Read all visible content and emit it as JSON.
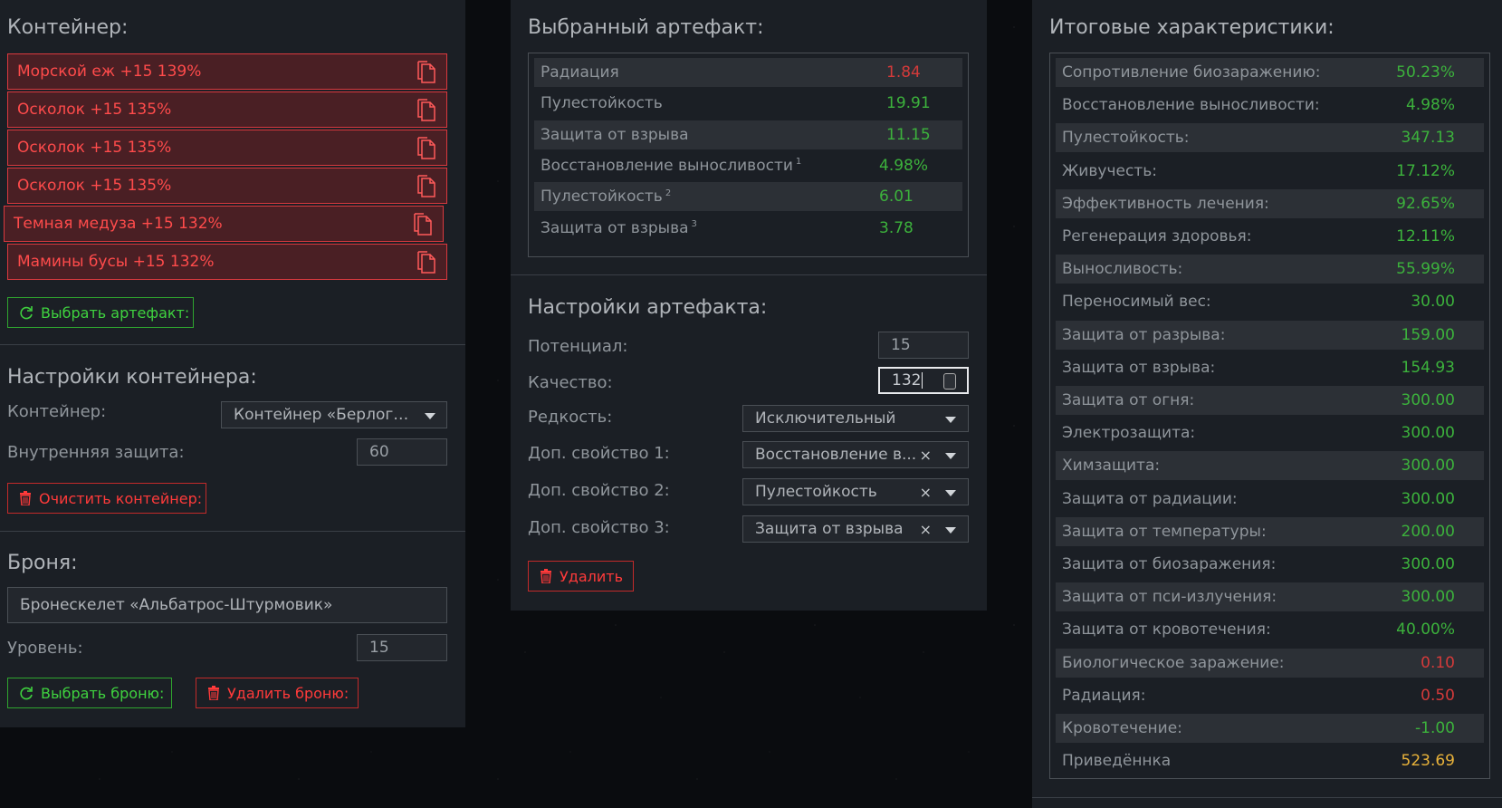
{
  "container": {
    "title": "Контейнер:",
    "artifacts": [
      {
        "label": "Морской еж +15 139%"
      },
      {
        "label": "Осколок +15 135%"
      },
      {
        "label": "Осколок +15 135%"
      },
      {
        "label": "Осколок +15 135%"
      },
      {
        "label": "Темная медуза +15 132%"
      },
      {
        "label": "Мамины бусы +15 132%"
      }
    ],
    "select_artifact_label": "Выбрать артефакт:"
  },
  "container_settings": {
    "title": "Настройки контейнера:",
    "container_label": "Контейнер:",
    "container_value": "Контейнер «Берлога...",
    "inner_protection_label": "Внутренняя защита:",
    "inner_protection_value": "60",
    "clear_label": "Очистить контейнер:"
  },
  "armor": {
    "title": "Броня:",
    "value": "Бронескелет «Альбатрос-Штурмовик»",
    "level_label": "Уровень:",
    "level_value": "15",
    "select_label": "Выбрать броню:",
    "delete_label": "Удалить броню:"
  },
  "selected_artifact": {
    "title": "Выбранный артефакт:",
    "rows": [
      {
        "name": "Радиация",
        "sup": "",
        "value": "1.84",
        "color": "red"
      },
      {
        "name": "Пулестойкость",
        "sup": "",
        "value": "19.91",
        "color": "green"
      },
      {
        "name": "Защита от взрыва",
        "sup": "",
        "value": "11.15",
        "color": "green"
      },
      {
        "name": "Восстановление выносливости",
        "sup": "1",
        "value": "4.98%",
        "color": "green"
      },
      {
        "name": "Пулестойкость",
        "sup": "2",
        "value": "6.01",
        "color": "green"
      },
      {
        "name": "Защита от взрыва",
        "sup": "3",
        "value": "3.78",
        "color": "green"
      }
    ]
  },
  "artifact_settings": {
    "title": "Настройки артефакта:",
    "potential_label": "Потенциал:",
    "potential_value": "15",
    "quality_label": "Качество:",
    "quality_value": "132",
    "rarity_label": "Редкость:",
    "rarity_value": "Исключительный",
    "extra1_label": "Доп. свойство 1:",
    "extra1_value": "Восстановление в...",
    "extra2_label": "Доп. свойство 2:",
    "extra2_value": "Пулестойкость",
    "extra3_label": "Доп. свойство 3:",
    "extra3_value": "Защита от взрыва",
    "clear_symbol": "×",
    "delete_label": "Удалить"
  },
  "totals": {
    "title": "Итоговые характеристики:",
    "rows": [
      {
        "name": "Сопротивление биозаражению:",
        "value": "50.23%",
        "color": "green"
      },
      {
        "name": "Восстановление выносливости:",
        "value": "4.98%",
        "color": "green"
      },
      {
        "name": "Пулестойкость:",
        "value": "347.13",
        "color": "green"
      },
      {
        "name": "Живучесть:",
        "value": "17.12%",
        "color": "green"
      },
      {
        "name": "Эффективность лечения:",
        "value": "92.65%",
        "color": "green"
      },
      {
        "name": "Регенерация здоровья:",
        "value": "12.11%",
        "color": "green"
      },
      {
        "name": "Выносливость:",
        "value": "55.99%",
        "color": "green"
      },
      {
        "name": "Переносимый вес:",
        "value": "30.00",
        "color": "green"
      },
      {
        "name": "Защита от разрыва:",
        "value": "159.00",
        "color": "green"
      },
      {
        "name": "Защита от взрыва:",
        "value": "154.93",
        "color": "green"
      },
      {
        "name": "Защита от огня:",
        "value": "300.00",
        "color": "green"
      },
      {
        "name": "Электрозащита:",
        "value": "300.00",
        "color": "green"
      },
      {
        "name": "Химзащита:",
        "value": "300.00",
        "color": "green"
      },
      {
        "name": "Защита от радиации:",
        "value": "300.00",
        "color": "green"
      },
      {
        "name": "Защита от температуры:",
        "value": "200.00",
        "color": "green"
      },
      {
        "name": "Защита от биозаражения:",
        "value": "300.00",
        "color": "green"
      },
      {
        "name": "Защита от пси-излучения:",
        "value": "300.00",
        "color": "green"
      },
      {
        "name": "Защита от кровотечения:",
        "value": "40.00%",
        "color": "green"
      },
      {
        "name": "Биологическое заражение:",
        "value": "0.10",
        "color": "red"
      },
      {
        "name": "Радиация:",
        "value": "0.50",
        "color": "red"
      },
      {
        "name": "Кровотечение:",
        "value": "-1.00",
        "color": "green"
      },
      {
        "name": "Приведённка",
        "value": "523.69",
        "color": "gold"
      }
    ]
  },
  "colors": {
    "accent_red": "#d9393e",
    "accent_green": "#3cb23c",
    "gold": "#e8b23a",
    "panel_bg": "#1b1f25"
  },
  "icons": {
    "copy": "copy-icon",
    "refresh": "refresh-icon",
    "trash": "trash-icon"
  }
}
